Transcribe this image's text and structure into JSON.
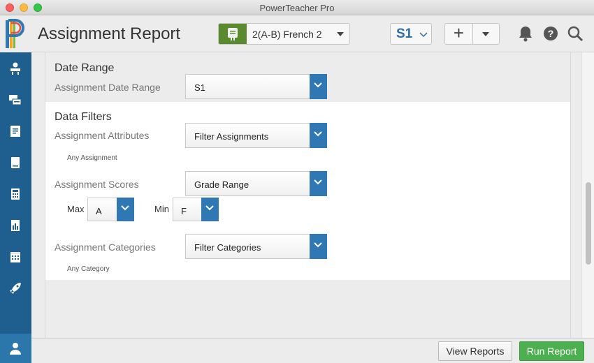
{
  "window": {
    "title": "PowerTeacher Pro"
  },
  "header": {
    "page_title": "Assignment Report",
    "class_selector": {
      "value": "2(A-B) French 2"
    },
    "term_selector": {
      "value": "S1"
    },
    "icons": [
      "add-icon",
      "dropdown-caret-icon",
      "bell-icon",
      "help-icon",
      "search-icon"
    ]
  },
  "sidebar": {
    "items": [
      {
        "icon": "seating-chart-icon"
      },
      {
        "icon": "messages-icon"
      },
      {
        "icon": "assignments-icon"
      },
      {
        "icon": "gradebook-icon"
      },
      {
        "icon": "calculator-icon"
      },
      {
        "icon": "reports-icon"
      },
      {
        "icon": "calendar-icon"
      },
      {
        "icon": "rocket-icon"
      }
    ],
    "bottom": {
      "icon": "user-icon"
    }
  },
  "date_range": {
    "title": "Date Range",
    "label": "Assignment Date Range",
    "value": "S1"
  },
  "data_filters": {
    "title": "Data Filters",
    "attributes": {
      "label": "Assignment Attributes",
      "value": "Filter Assignments",
      "note": "Any Assignment"
    },
    "scores": {
      "label": "Assignment Scores",
      "value": "Grade Range",
      "max_label": "Max",
      "max_value": "A",
      "min_label": "Min",
      "min_value": "F"
    },
    "categories": {
      "label": "Assignment Categories",
      "value": "Filter Categories",
      "note": "Any Category"
    }
  },
  "footer": {
    "view_reports": "View Reports",
    "run_report": "Run Report"
  },
  "colors": {
    "sidebar": "#1f5f8f",
    "accent": "#2f78b4",
    "run": "#4caf50",
    "class_icon": "#5a8a2e"
  }
}
